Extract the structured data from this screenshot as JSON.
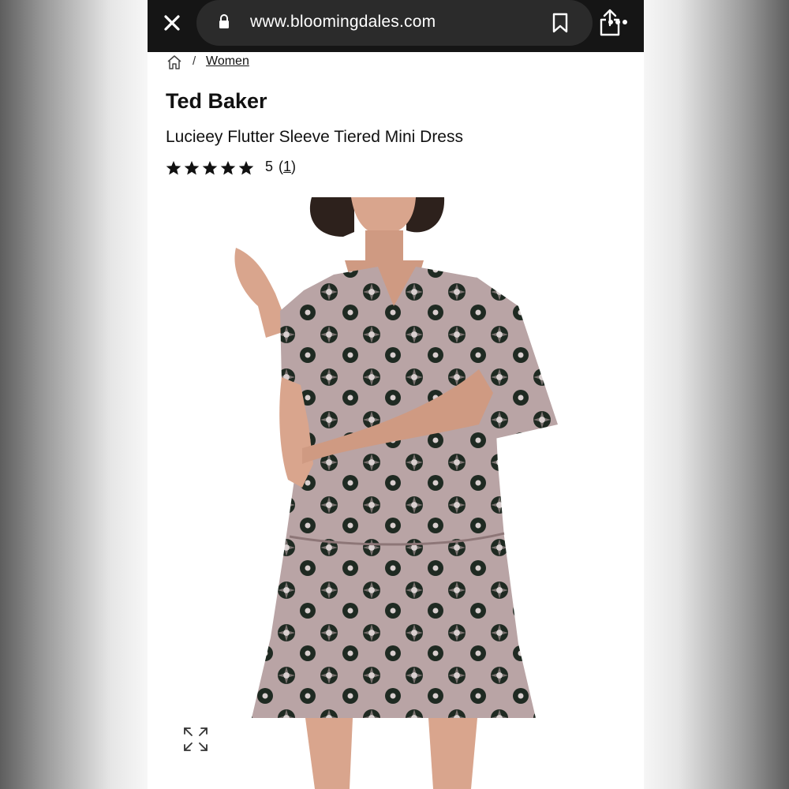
{
  "browser": {
    "url": "www.bloomingdales.com",
    "close_icon": "close-icon",
    "lock_icon": "lock-icon",
    "bookmark_icon": "bookmark-icon",
    "share_icon": "share-icon",
    "more_icon": "more-icon"
  },
  "breadcrumb": {
    "home_icon": "home-icon",
    "separator": "/",
    "items": [
      {
        "label": "Women"
      }
    ]
  },
  "product": {
    "brand": "Ted Baker",
    "name": "Lucieey Flutter Sleeve Tiered Mini Dress",
    "rating": {
      "stars": 5,
      "max_stars": 5,
      "value": "5",
      "count_open": "(",
      "count": "1",
      "count_close": ")"
    },
    "image": {
      "description_icon": "product-photo",
      "expand_icon": "expand-icon"
    }
  },
  "colors": {
    "topbar": "#151515",
    "url_pill": "#2b2b2b",
    "text": "#111111",
    "dress": "#b8a3a4",
    "print": "#1f2a22"
  }
}
